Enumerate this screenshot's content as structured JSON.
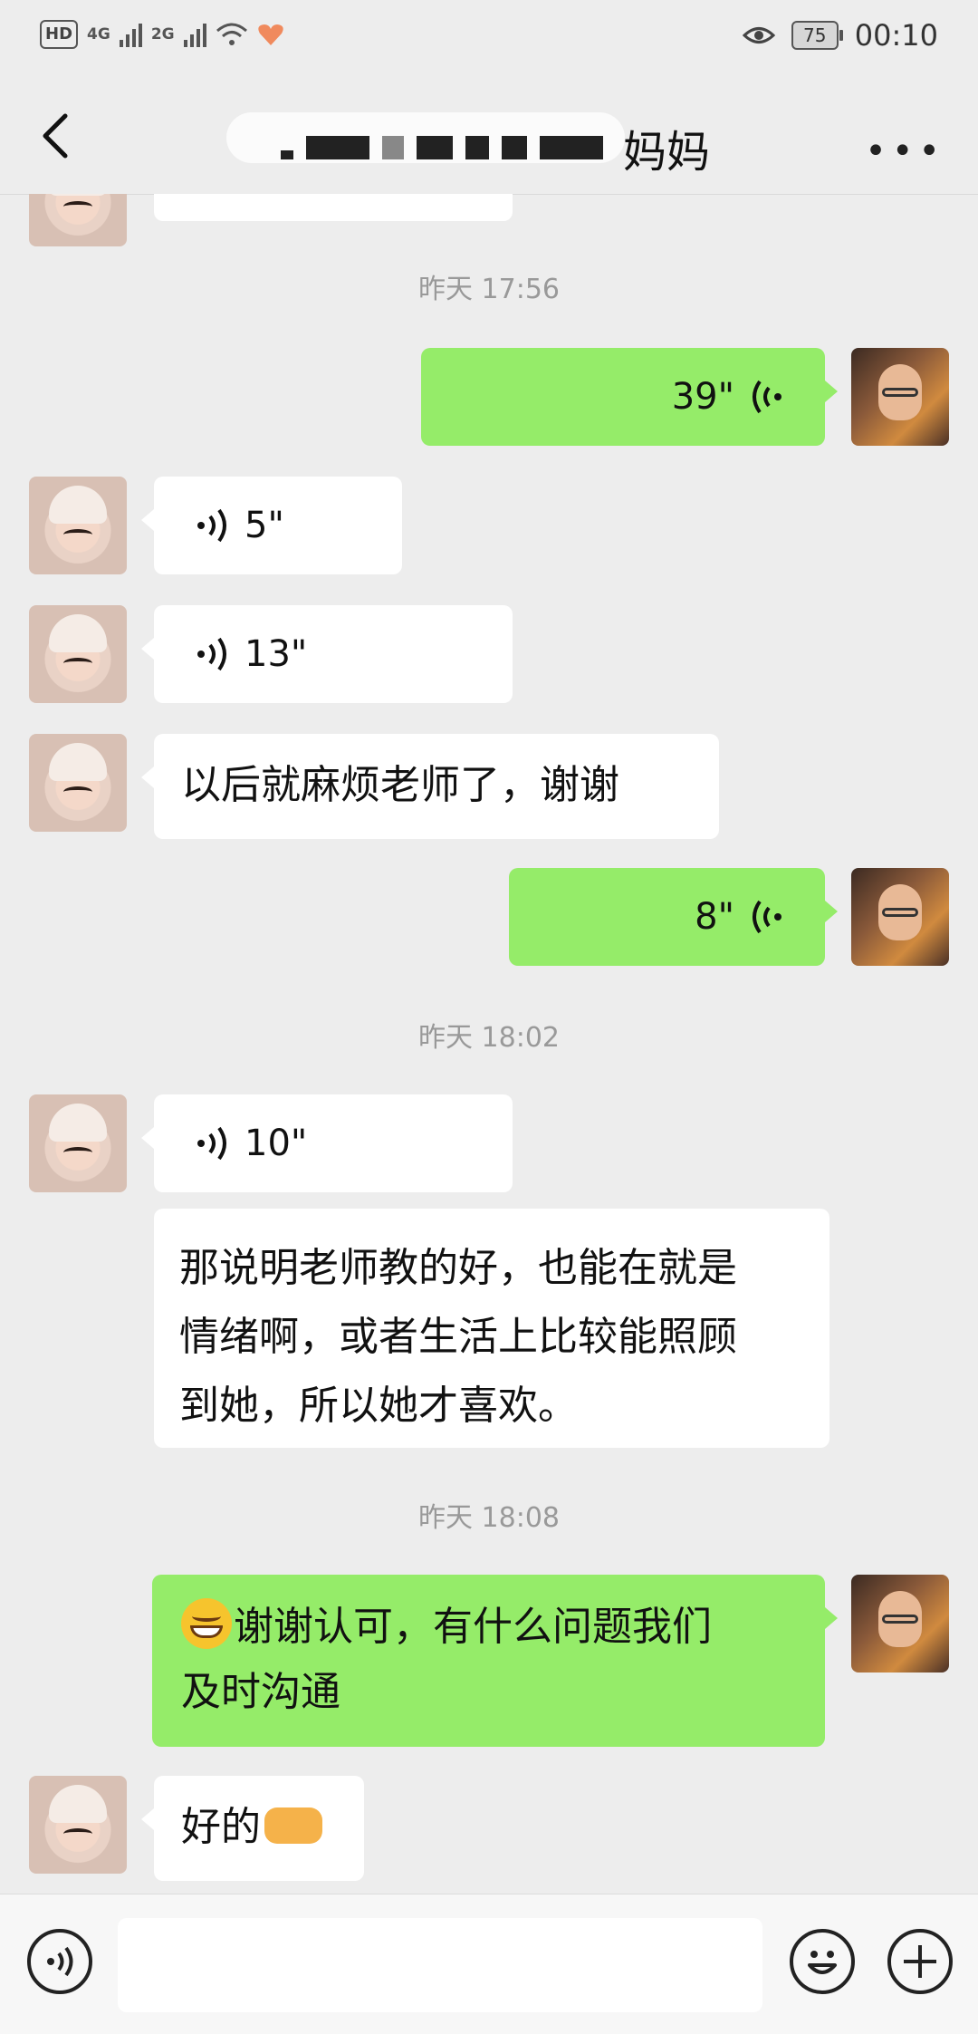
{
  "status_bar": {
    "hd": "HD",
    "sim1": "4G",
    "sim2": "2G",
    "battery": "75",
    "time": "00:10"
  },
  "header": {
    "title_visible": "妈妈"
  },
  "messages": {
    "ts1": "昨天 17:56",
    "m1": "39\"",
    "m2": "5\"",
    "m3": "13\"",
    "m4": "以后就麻烦老师了，谢谢",
    "m5": "8\"",
    "ts2": "昨天 18:02",
    "m6": "10\"",
    "m7_line1": "那说明老师教的好，也能在就是",
    "m7_line2": "情绪啊，或者生活上比较能照顾",
    "m7_line3": "到她，所以她才喜欢。",
    "ts3": "昨天 18:08",
    "m8_line1": "谢谢认可，有什么问题我们",
    "m8_line2": "及时沟通",
    "m9": "好的"
  },
  "icons": [
    "back-arrow-icon",
    "more-icon",
    "voice-icon",
    "emoji-icon",
    "plus-icon"
  ]
}
